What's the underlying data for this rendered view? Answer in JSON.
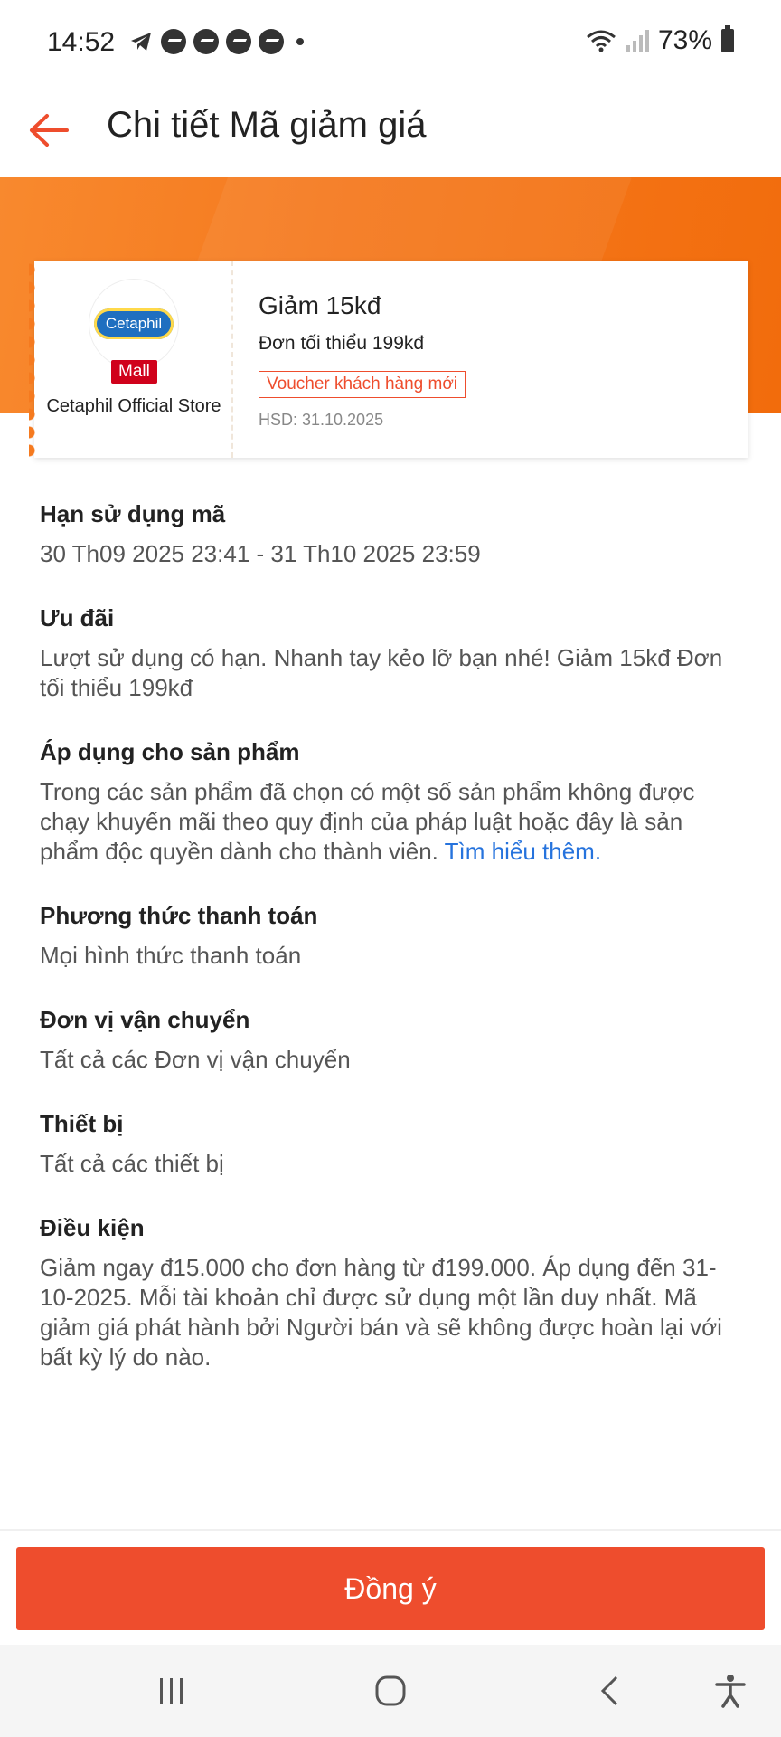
{
  "status_bar": {
    "time": "14:52",
    "battery": "73%",
    "icons": [
      "telegram-icon",
      "messenger-icon",
      "messenger-icon",
      "messenger-icon",
      "chat-icon",
      "dot-icon",
      "wifi-icon",
      "signal-icon",
      "battery-icon"
    ]
  },
  "header": {
    "title": "Chi tiết Mã giảm giá",
    "back_icon": "arrow-left-icon"
  },
  "colors": {
    "accent": "#ee4d2d",
    "banner": "#f57a1f",
    "link": "#2673dd",
    "mall": "#d0011b"
  },
  "voucher": {
    "logo_text": "Cetaphil",
    "mall_badge": "Mall",
    "store_name": "Cetaphil Official Store",
    "title": "Giảm 15kđ",
    "min_order": "Đơn tối thiểu 199kđ",
    "tag": "Voucher khách hàng mới",
    "expiry": "HSD: 31.10.2025"
  },
  "sections": [
    {
      "heading": "Hạn sử dụng mã",
      "body": "30 Th09 2025 23:41 - 31 Th10 2025 23:59"
    },
    {
      "heading": "Ưu đãi",
      "body": "Lượt sử dụng có hạn. Nhanh tay kẻo lỡ bạn nhé! Giảm 15kđ Đơn tối thiểu 199kđ"
    },
    {
      "heading": "Áp dụng cho sản phẩm",
      "body": "Trong các sản phẩm đã chọn có một số sản phẩm không được chạy khuyến mãi theo quy định của pháp luật hoặc đây là sản phẩm độc quyền dành cho thành viên.",
      "link": "Tìm hiểu thêm."
    },
    {
      "heading": "Phương thức thanh toán",
      "body": "Mọi hình thức thanh toán"
    },
    {
      "heading": "Đơn vị vận chuyển",
      "body": "Tất cả các Đơn vị vận chuyển"
    },
    {
      "heading": "Thiết bị",
      "body": "Tất cả các thiết bị"
    },
    {
      "heading": "Điều kiện",
      "body": "Giảm ngay đ15.000 cho đơn hàng từ đ199.000. Áp dụng đến 31-10-2025. Mỗi tài khoản chỉ được sử dụng một lần duy nhất. Mã giảm giá phát hành bởi Người bán và sẽ không được hoàn lại với bất kỳ lý do nào."
    }
  ],
  "footer": {
    "agree_label": "Đồng ý"
  },
  "nav_bar": {
    "icons": [
      "recent-apps-icon",
      "home-icon",
      "back-icon",
      "accessibility-icon"
    ]
  }
}
